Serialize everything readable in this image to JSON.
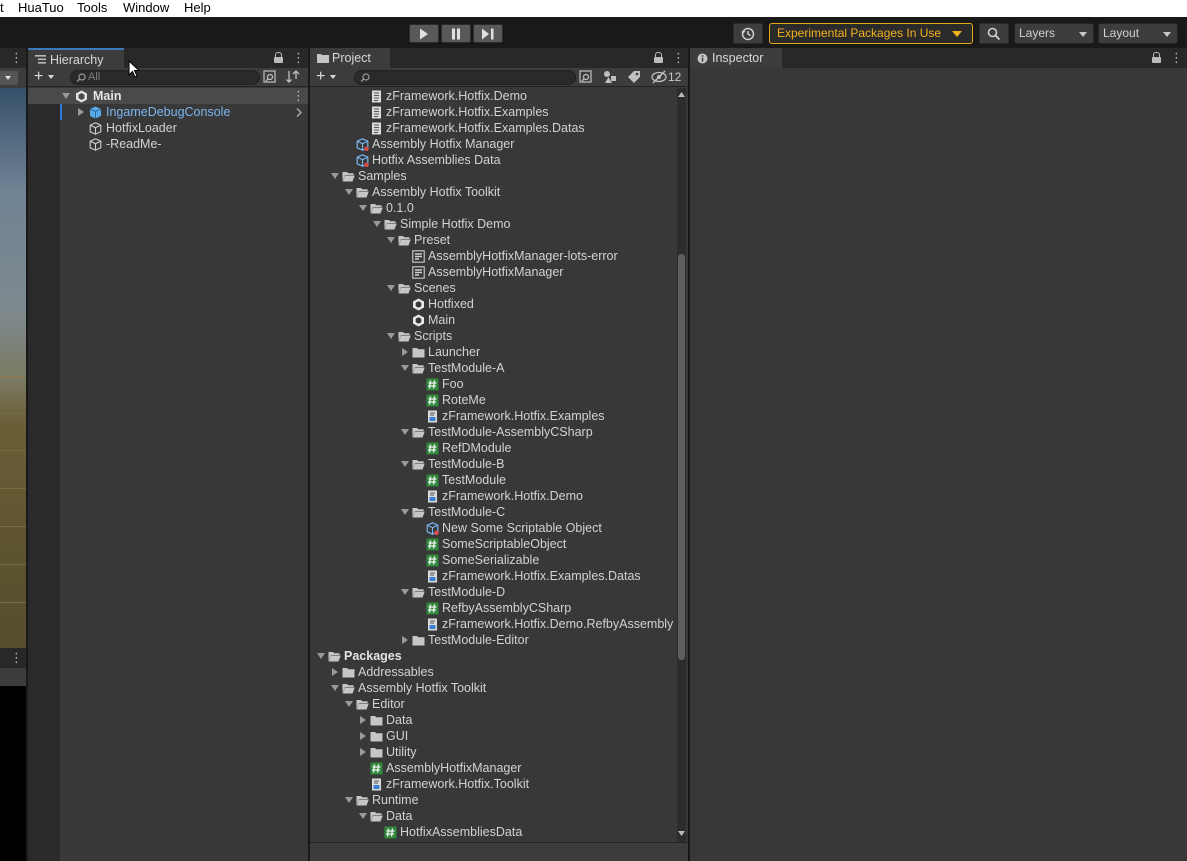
{
  "menu": [
    "t",
    "HuaTuo",
    "Tools",
    "Window",
    "Help"
  ],
  "toolbar": {
    "experimental_label": "Experimental Packages In Use",
    "layers_label": "Layers",
    "layout_label": "Layout",
    "colors": {
      "warning": "#f4b21c"
    }
  },
  "hierarchy": {
    "tab_label": "Hierarchy",
    "search_placeholder": "All",
    "scene": "Main",
    "items": [
      "IngameDebugConsole",
      "HotfixLoader",
      "-ReadMe-"
    ]
  },
  "project": {
    "tab_label": "Project",
    "hidden_count": "12",
    "items": [
      {
        "label": "zFramework.Hotfix.Demo",
        "icon": "doc",
        "depth": 3,
        "fold": "none"
      },
      {
        "label": "zFramework.Hotfix.Examples",
        "icon": "doc",
        "depth": 3,
        "fold": "none"
      },
      {
        "label": "zFramework.Hotfix.Examples.Datas",
        "icon": "doc",
        "depth": 3,
        "fold": "none"
      },
      {
        "label": "Assembly Hotfix Manager",
        "icon": "so",
        "depth": 2,
        "fold": "none"
      },
      {
        "label": "Hotfix Assemblies Data",
        "icon": "so",
        "depth": 2,
        "fold": "none"
      },
      {
        "label": "Samples",
        "icon": "folder-open",
        "depth": 1,
        "fold": "open"
      },
      {
        "label": "Assembly Hotfix Toolkit",
        "icon": "folder-open",
        "depth": 2,
        "fold": "open"
      },
      {
        "label": "0.1.0",
        "icon": "folder-open",
        "depth": 3,
        "fold": "open"
      },
      {
        "label": "Simple Hotfix Demo",
        "icon": "folder-open",
        "depth": 4,
        "fold": "open"
      },
      {
        "label": "Preset",
        "icon": "folder-open",
        "depth": 5,
        "fold": "open"
      },
      {
        "label": "AssemblyHotfixManager-lots-error",
        "icon": "preset",
        "depth": 6,
        "fold": "none"
      },
      {
        "label": "AssemblyHotfixManager",
        "icon": "preset",
        "depth": 6,
        "fold": "none"
      },
      {
        "label": "Scenes",
        "icon": "folder-open",
        "depth": 5,
        "fold": "open"
      },
      {
        "label": "Hotfixed",
        "icon": "unity",
        "depth": 6,
        "fold": "none"
      },
      {
        "label": "Main",
        "icon": "unity",
        "depth": 6,
        "fold": "none"
      },
      {
        "label": "Scripts",
        "icon": "folder-open",
        "depth": 5,
        "fold": "open"
      },
      {
        "label": "Launcher",
        "icon": "folder",
        "depth": 6,
        "fold": "closed"
      },
      {
        "label": "TestModule-A",
        "icon": "folder-open",
        "depth": 6,
        "fold": "open"
      },
      {
        "label": "Foo",
        "icon": "cs",
        "depth": 7,
        "fold": "none"
      },
      {
        "label": "RoteMe",
        "icon": "cs",
        "depth": 7,
        "fold": "none"
      },
      {
        "label": "zFramework.Hotfix.Examples",
        "icon": "asmdef",
        "depth": 7,
        "fold": "none"
      },
      {
        "label": "TestModule-AssemblyCSharp",
        "icon": "folder-open",
        "depth": 6,
        "fold": "open"
      },
      {
        "label": "RefDModule",
        "icon": "cs",
        "depth": 7,
        "fold": "none"
      },
      {
        "label": "TestModule-B",
        "icon": "folder-open",
        "depth": 6,
        "fold": "open"
      },
      {
        "label": "TestModule",
        "icon": "cs",
        "depth": 7,
        "fold": "none"
      },
      {
        "label": "zFramework.Hotfix.Demo",
        "icon": "asmdef",
        "depth": 7,
        "fold": "none"
      },
      {
        "label": "TestModule-C",
        "icon": "folder-open",
        "depth": 6,
        "fold": "open"
      },
      {
        "label": "New Some Scriptable Object",
        "icon": "so",
        "depth": 7,
        "fold": "none"
      },
      {
        "label": "SomeScriptableObject",
        "icon": "cs",
        "depth": 7,
        "fold": "none"
      },
      {
        "label": "SomeSerializable",
        "icon": "cs",
        "depth": 7,
        "fold": "none"
      },
      {
        "label": "zFramework.Hotfix.Examples.Datas",
        "icon": "asmdef",
        "depth": 7,
        "fold": "none"
      },
      {
        "label": "TestModule-D",
        "icon": "folder-open",
        "depth": 6,
        "fold": "open"
      },
      {
        "label": "RefbyAssemblyCSharp",
        "icon": "cs",
        "depth": 7,
        "fold": "none"
      },
      {
        "label": "zFramework.Hotfix.Demo.RefbyAssembly",
        "icon": "asmdef",
        "depth": 7,
        "fold": "none"
      },
      {
        "label": "TestModule-Editor",
        "icon": "folder",
        "depth": 6,
        "fold": "closed"
      },
      {
        "label": "Packages",
        "icon": "folder-open",
        "depth": 0,
        "fold": "open",
        "bold": true
      },
      {
        "label": "Addressables",
        "icon": "folder",
        "depth": 1,
        "fold": "closed"
      },
      {
        "label": "Assembly Hotfix Toolkit",
        "icon": "folder-open",
        "depth": 1,
        "fold": "open"
      },
      {
        "label": "Editor",
        "icon": "folder-open",
        "depth": 2,
        "fold": "open"
      },
      {
        "label": "Data",
        "icon": "folder",
        "depth": 3,
        "fold": "closed"
      },
      {
        "label": "GUI",
        "icon": "folder",
        "depth": 3,
        "fold": "closed"
      },
      {
        "label": "Utility",
        "icon": "folder",
        "depth": 3,
        "fold": "closed"
      },
      {
        "label": "AssemblyHotfixManager",
        "icon": "cs",
        "depth": 3,
        "fold": "none"
      },
      {
        "label": "zFramework.Hotfix.Toolkit",
        "icon": "asmdef",
        "depth": 3,
        "fold": "none"
      },
      {
        "label": "Runtime",
        "icon": "folder-open",
        "depth": 2,
        "fold": "open"
      },
      {
        "label": "Data",
        "icon": "folder-open",
        "depth": 3,
        "fold": "open"
      },
      {
        "label": "HotfixAssembliesData",
        "icon": "cs",
        "depth": 4,
        "fold": "none"
      }
    ]
  },
  "inspector": {
    "tab_label": "Inspector"
  }
}
